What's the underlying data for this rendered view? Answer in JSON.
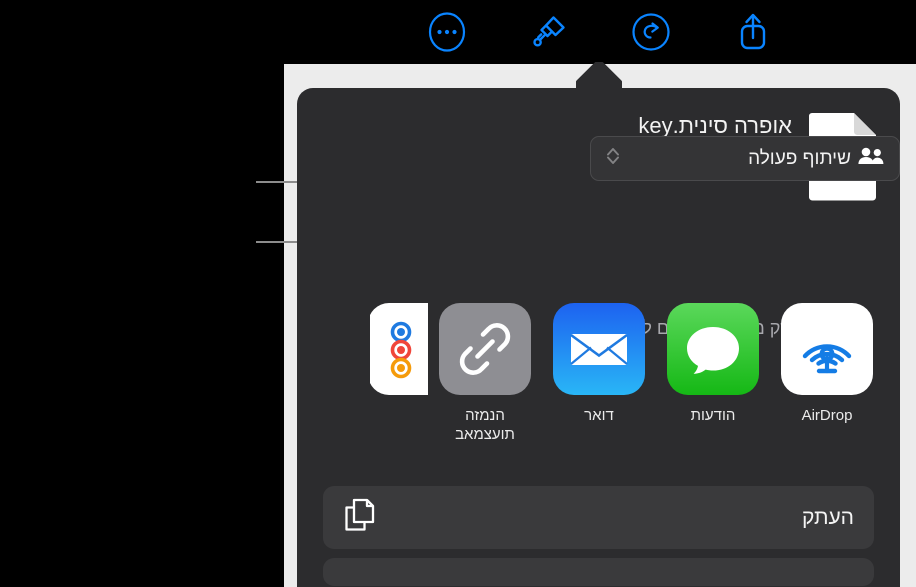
{
  "toolbar": {
    "buttons": [
      {
        "name": "more-options",
        "icon": "ellipsis-circle-icon",
        "color": "#0a84ff"
      },
      {
        "name": "format-brush",
        "icon": "paintbrush-icon",
        "color": "#0a84ff"
      },
      {
        "name": "redo",
        "icon": "redo-circle-icon",
        "color": "#0a84ff"
      },
      {
        "name": "share",
        "icon": "share-icon",
        "color": "#0a84ff"
      }
    ]
  },
  "callouts": {
    "line_color": "#8c8c8c",
    "items": [
      {
        "target": "collaboration-button"
      },
      {
        "target": "permissions-summary"
      }
    ]
  },
  "share_sheet": {
    "document_title": "אופרה סינית.key",
    "document_icon": "keynote-document-icon",
    "collaboration": {
      "label": "שיתוף פעולה",
      "people_icon": "people-icon",
      "popup_icon": "chevron-up-down-icon"
    },
    "permissions": {
      "text": "רק מוזמנים יכולים לערוך",
      "chevron_icon": "chevron-left-icon"
    },
    "apps": [
      {
        "label": "",
        "icon": "freeform-icon",
        "partial": true
      },
      {
        "label": "הזמנה באמצעות",
        "label_line_1": "הנמזה",
        "label_line_2": "תועצמאב",
        "icon": "link-icon"
      },
      {
        "label": "דואר",
        "icon": "mail-icon"
      },
      {
        "label": "הודעות",
        "icon": "messages-icon"
      },
      {
        "label": "AirDrop",
        "icon": "airdrop-icon"
      }
    ],
    "actions": [
      {
        "label": "העתק",
        "icon": "copy-documents-icon"
      }
    ]
  },
  "colors": {
    "accent": "#0a84ff",
    "sheet_bg": "#2c2c2e",
    "row_bg": "#3a3a3c",
    "page_bg": "#ececec",
    "toolbar_bg": "#000000",
    "title_text": "#f2f2f2",
    "secondary_text": "#a8a8ad"
  }
}
